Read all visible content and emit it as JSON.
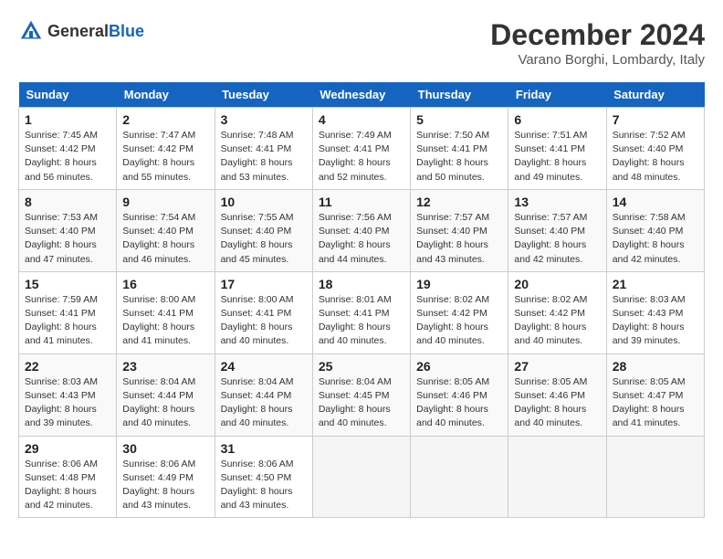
{
  "header": {
    "logo_general": "General",
    "logo_blue": "Blue",
    "month_year": "December 2024",
    "location": "Varano Borghi, Lombardy, Italy"
  },
  "calendar": {
    "days_of_week": [
      "Sunday",
      "Monday",
      "Tuesday",
      "Wednesday",
      "Thursday",
      "Friday",
      "Saturday"
    ],
    "weeks": [
      [
        null,
        null,
        null,
        null,
        null,
        null,
        null
      ]
    ],
    "cells": [
      {
        "day": null,
        "info": null
      },
      {
        "day": null,
        "info": null
      },
      {
        "day": null,
        "info": null
      },
      {
        "day": null,
        "info": null
      },
      {
        "day": null,
        "info": null
      },
      {
        "day": null,
        "info": null
      },
      {
        "day": null,
        "info": null
      }
    ],
    "rows": [
      [
        {
          "day": "1",
          "info": "Sunrise: 7:45 AM\nSunset: 4:42 PM\nDaylight: 8 hours\nand 56 minutes."
        },
        {
          "day": "2",
          "info": "Sunrise: 7:47 AM\nSunset: 4:42 PM\nDaylight: 8 hours\nand 55 minutes."
        },
        {
          "day": "3",
          "info": "Sunrise: 7:48 AM\nSunset: 4:41 PM\nDaylight: 8 hours\nand 53 minutes."
        },
        {
          "day": "4",
          "info": "Sunrise: 7:49 AM\nSunset: 4:41 PM\nDaylight: 8 hours\nand 52 minutes."
        },
        {
          "day": "5",
          "info": "Sunrise: 7:50 AM\nSunset: 4:41 PM\nDaylight: 8 hours\nand 50 minutes."
        },
        {
          "day": "6",
          "info": "Sunrise: 7:51 AM\nSunset: 4:41 PM\nDaylight: 8 hours\nand 49 minutes."
        },
        {
          "day": "7",
          "info": "Sunrise: 7:52 AM\nSunset: 4:40 PM\nDaylight: 8 hours\nand 48 minutes."
        }
      ],
      [
        {
          "day": "8",
          "info": "Sunrise: 7:53 AM\nSunset: 4:40 PM\nDaylight: 8 hours\nand 47 minutes."
        },
        {
          "day": "9",
          "info": "Sunrise: 7:54 AM\nSunset: 4:40 PM\nDaylight: 8 hours\nand 46 minutes."
        },
        {
          "day": "10",
          "info": "Sunrise: 7:55 AM\nSunset: 4:40 PM\nDaylight: 8 hours\nand 45 minutes."
        },
        {
          "day": "11",
          "info": "Sunrise: 7:56 AM\nSunset: 4:40 PM\nDaylight: 8 hours\nand 44 minutes."
        },
        {
          "day": "12",
          "info": "Sunrise: 7:57 AM\nSunset: 4:40 PM\nDaylight: 8 hours\nand 43 minutes."
        },
        {
          "day": "13",
          "info": "Sunrise: 7:57 AM\nSunset: 4:40 PM\nDaylight: 8 hours\nand 42 minutes."
        },
        {
          "day": "14",
          "info": "Sunrise: 7:58 AM\nSunset: 4:40 PM\nDaylight: 8 hours\nand 42 minutes."
        }
      ],
      [
        {
          "day": "15",
          "info": "Sunrise: 7:59 AM\nSunset: 4:41 PM\nDaylight: 8 hours\nand 41 minutes."
        },
        {
          "day": "16",
          "info": "Sunrise: 8:00 AM\nSunset: 4:41 PM\nDaylight: 8 hours\nand 41 minutes."
        },
        {
          "day": "17",
          "info": "Sunrise: 8:00 AM\nSunset: 4:41 PM\nDaylight: 8 hours\nand 40 minutes."
        },
        {
          "day": "18",
          "info": "Sunrise: 8:01 AM\nSunset: 4:41 PM\nDaylight: 8 hours\nand 40 minutes."
        },
        {
          "day": "19",
          "info": "Sunrise: 8:02 AM\nSunset: 4:42 PM\nDaylight: 8 hours\nand 40 minutes."
        },
        {
          "day": "20",
          "info": "Sunrise: 8:02 AM\nSunset: 4:42 PM\nDaylight: 8 hours\nand 40 minutes."
        },
        {
          "day": "21",
          "info": "Sunrise: 8:03 AM\nSunset: 4:43 PM\nDaylight: 8 hours\nand 39 minutes."
        }
      ],
      [
        {
          "day": "22",
          "info": "Sunrise: 8:03 AM\nSunset: 4:43 PM\nDaylight: 8 hours\nand 39 minutes."
        },
        {
          "day": "23",
          "info": "Sunrise: 8:04 AM\nSunset: 4:44 PM\nDaylight: 8 hours\nand 40 minutes."
        },
        {
          "day": "24",
          "info": "Sunrise: 8:04 AM\nSunset: 4:44 PM\nDaylight: 8 hours\nand 40 minutes."
        },
        {
          "day": "25",
          "info": "Sunrise: 8:04 AM\nSunset: 4:45 PM\nDaylight: 8 hours\nand 40 minutes."
        },
        {
          "day": "26",
          "info": "Sunrise: 8:05 AM\nSunset: 4:46 PM\nDaylight: 8 hours\nand 40 minutes."
        },
        {
          "day": "27",
          "info": "Sunrise: 8:05 AM\nSunset: 4:46 PM\nDaylight: 8 hours\nand 40 minutes."
        },
        {
          "day": "28",
          "info": "Sunrise: 8:05 AM\nSunset: 4:47 PM\nDaylight: 8 hours\nand 41 minutes."
        }
      ],
      [
        {
          "day": "29",
          "info": "Sunrise: 8:06 AM\nSunset: 4:48 PM\nDaylight: 8 hours\nand 42 minutes."
        },
        {
          "day": "30",
          "info": "Sunrise: 8:06 AM\nSunset: 4:49 PM\nDaylight: 8 hours\nand 43 minutes."
        },
        {
          "day": "31",
          "info": "Sunrise: 8:06 AM\nSunset: 4:50 PM\nDaylight: 8 hours\nand 43 minutes."
        },
        {
          "day": null,
          "info": null
        },
        {
          "day": null,
          "info": null
        },
        {
          "day": null,
          "info": null
        },
        {
          "day": null,
          "info": null
        }
      ]
    ]
  }
}
